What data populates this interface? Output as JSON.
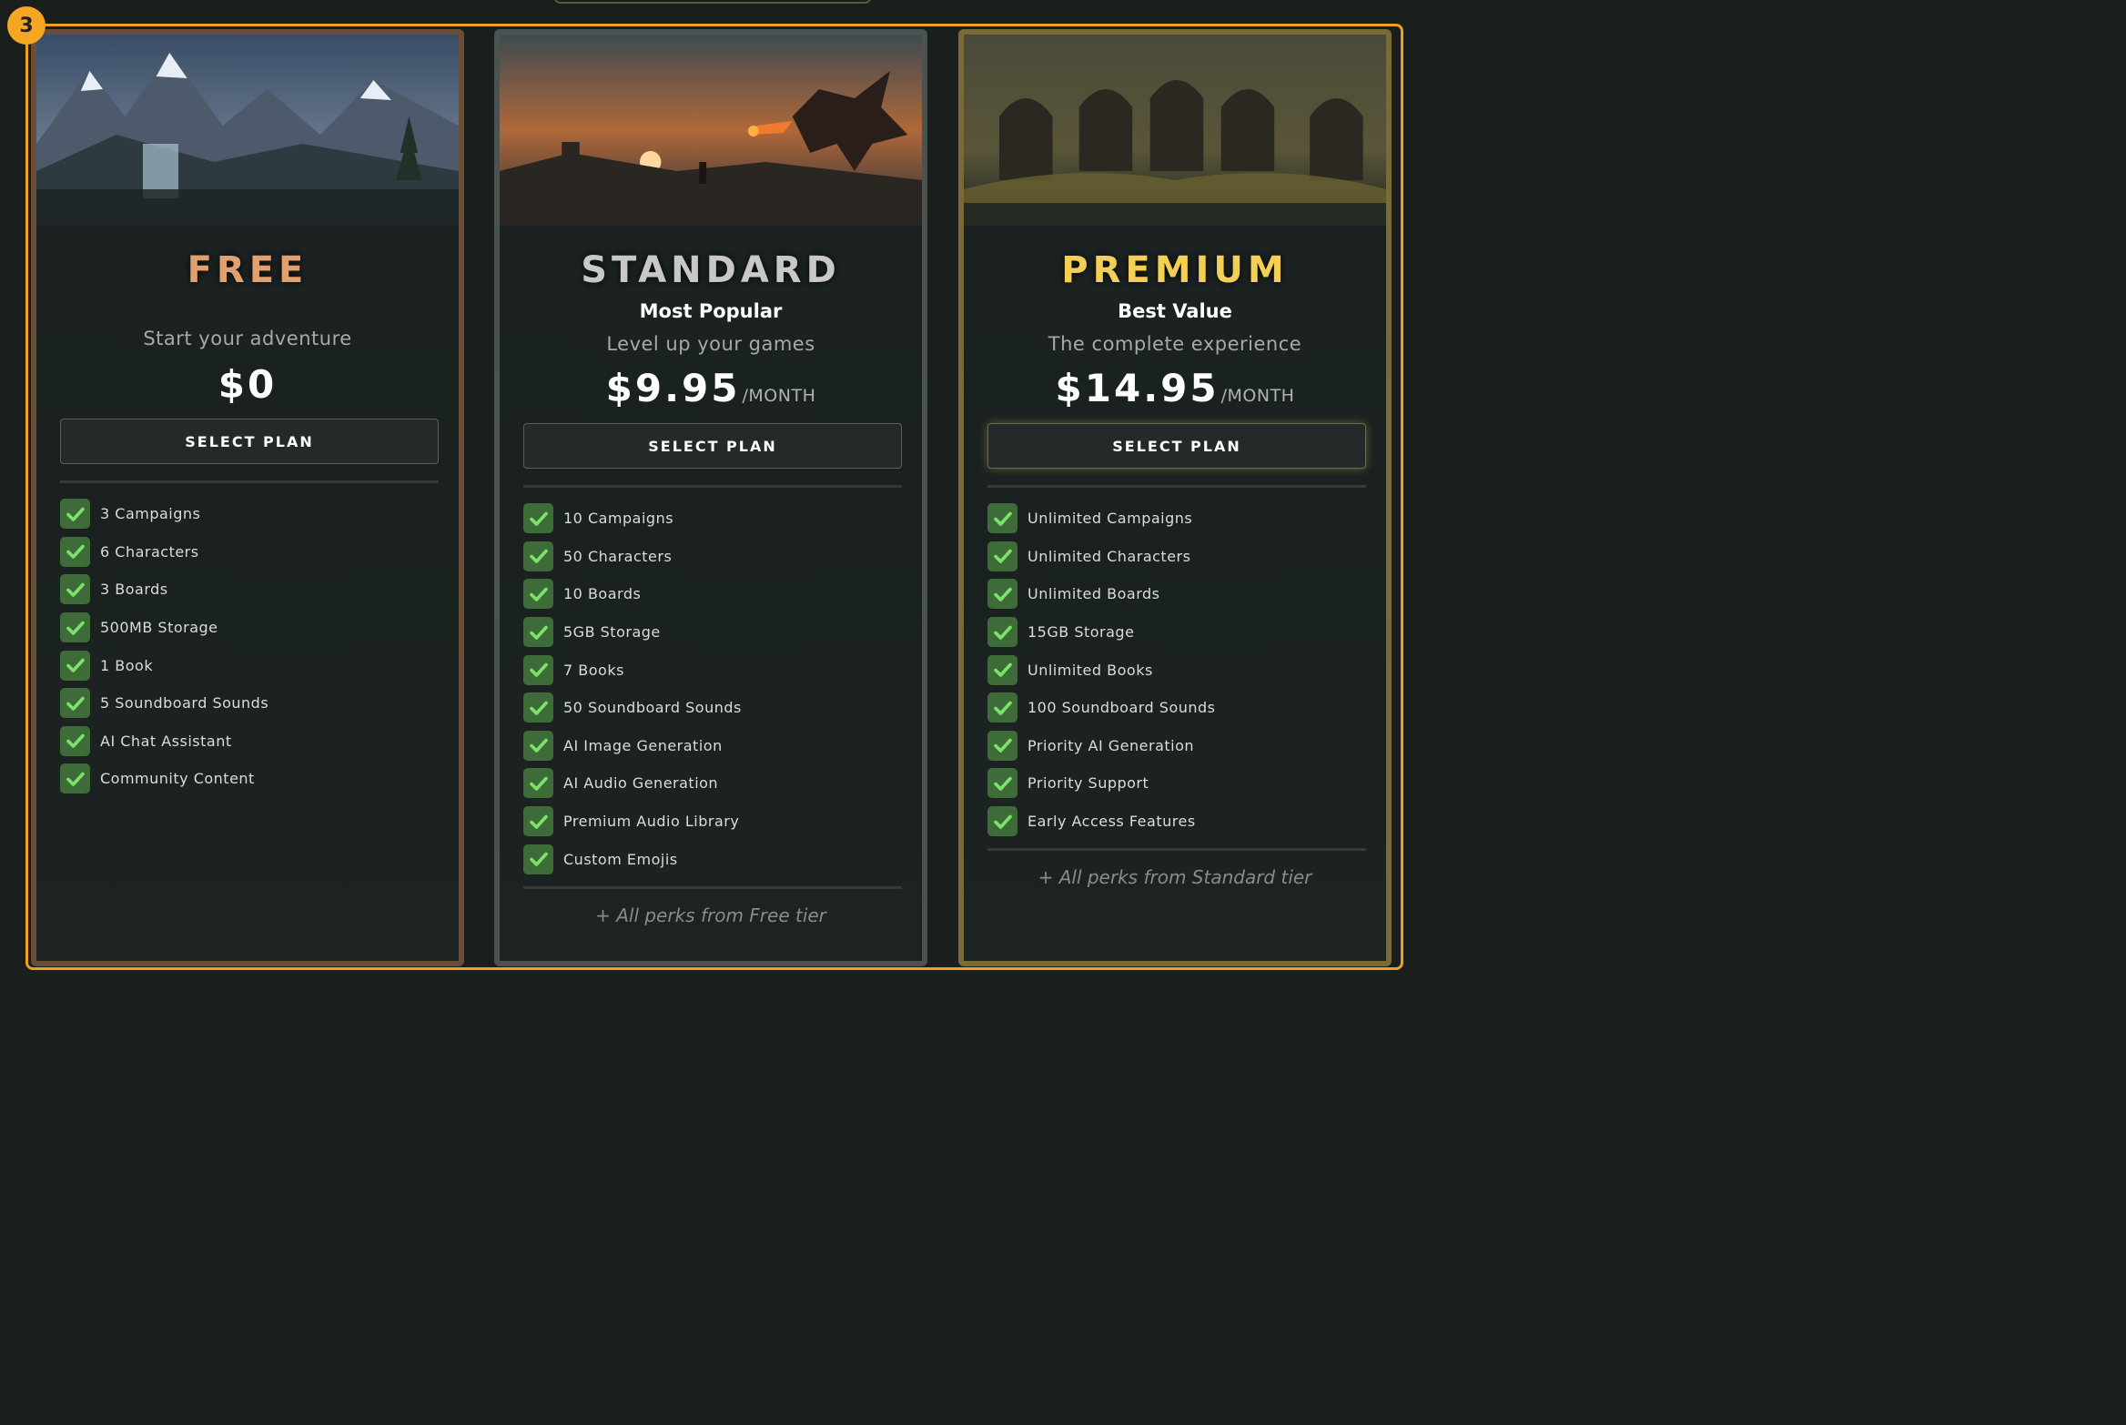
{
  "step_badge": "3",
  "plans": [
    {
      "id": "free",
      "name": "FREE",
      "tag": "",
      "tagline": "Start your adventure",
      "price": "$0",
      "period": "",
      "button_label": "SELECT PLAN",
      "features": [
        "3 Campaigns",
        "6 Characters",
        "3 Boards",
        "500MB Storage",
        "1 Book",
        "5 Soundboard Sounds",
        "AI Chat Assistant",
        "Community Content"
      ],
      "perks": ""
    },
    {
      "id": "standard",
      "name": "STANDARD",
      "tag": "Most Popular",
      "tagline": "Level up your games",
      "price": "$9.95",
      "period": "/MONTH",
      "button_label": "SELECT PLAN",
      "features": [
        "10 Campaigns",
        "50 Characters",
        "10 Boards",
        "5GB Storage",
        "7 Books",
        "50 Soundboard Sounds",
        "AI Image Generation",
        "AI Audio Generation",
        "Premium Audio Library",
        "Custom Emojis"
      ],
      "perks": "+ All perks from Free tier"
    },
    {
      "id": "premium",
      "name": "PREMIUM",
      "tag": "Best Value",
      "tagline": "The complete experience",
      "price": "$14.95",
      "period": "/MONTH",
      "button_label": "SELECT PLAN",
      "features": [
        "Unlimited Campaigns",
        "Unlimited Characters",
        "Unlimited Boards",
        "15GB Storage",
        "Unlimited Books",
        "100 Soundboard Sounds",
        "Priority AI Generation",
        "Priority Support",
        "Early Access Features"
      ],
      "perks": "+ All perks from Standard tier"
    }
  ],
  "colors": {
    "frame_accent": "#f0a020",
    "free_title": "#e0a070",
    "standard_title": "#c8c8c8",
    "premium_title": "#f3cf55",
    "check_bg": "#3e6c38",
    "check_mark": "#7ce36a"
  }
}
